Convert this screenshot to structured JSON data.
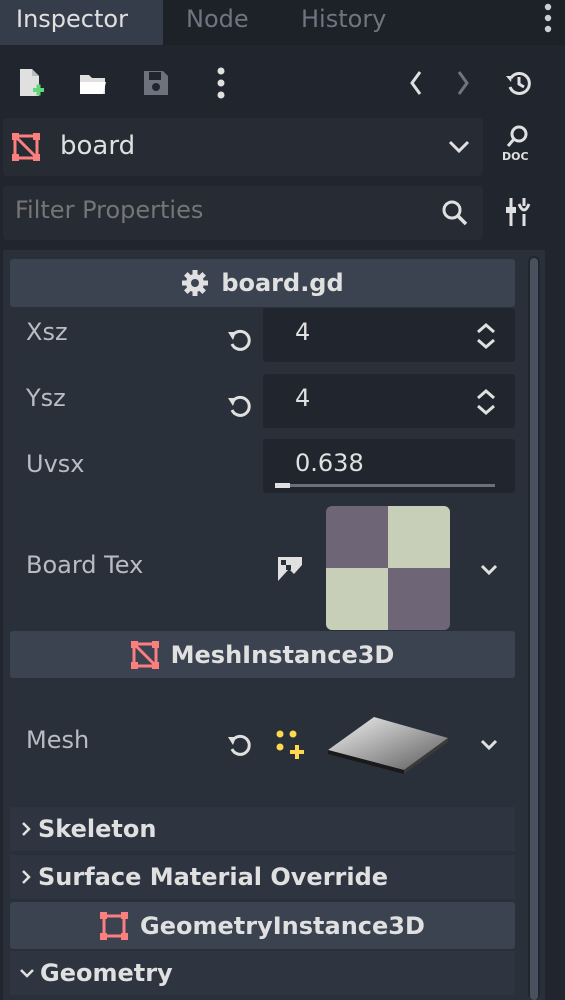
{
  "tabs": [
    {
      "label": "Inspector",
      "active": true
    },
    {
      "label": "Node",
      "active": false
    },
    {
      "label": "History",
      "active": false
    }
  ],
  "toolbar": {
    "icons": [
      "new-resource-icon",
      "open-folder-icon",
      "save-icon",
      "more-vertical-icon",
      "history-back-icon",
      "history-forward-icon",
      "recent-history-icon"
    ]
  },
  "object_selector": {
    "label": "board",
    "icon": "mesh-node-icon",
    "doc_label": "DOC"
  },
  "filter": {
    "placeholder": "Filter Properties"
  },
  "script_section": {
    "title": "board.gd"
  },
  "properties": {
    "xsz": {
      "label": "Xsz",
      "value": "4"
    },
    "ysz": {
      "label": "Ysz",
      "value": "4"
    },
    "uvsx": {
      "label": "Uvsx",
      "value": "0.638",
      "slider_fraction": 0.07
    },
    "board_tex": {
      "label": "Board Tex"
    },
    "mesh": {
      "label": "Mesh"
    }
  },
  "mesh_section": {
    "title": "MeshInstance3D"
  },
  "groups": {
    "skeleton": "Skeleton",
    "surface_material_override": "Surface Material Override",
    "geometry": "Geometry"
  },
  "geometry_section": {
    "title": "GeometryInstance3D"
  },
  "colors": {
    "accent": "#fc7f7f",
    "texture_dark": "#6e6577",
    "texture_light": "#c7cfb9",
    "new_icon": "#ffd84f"
  }
}
